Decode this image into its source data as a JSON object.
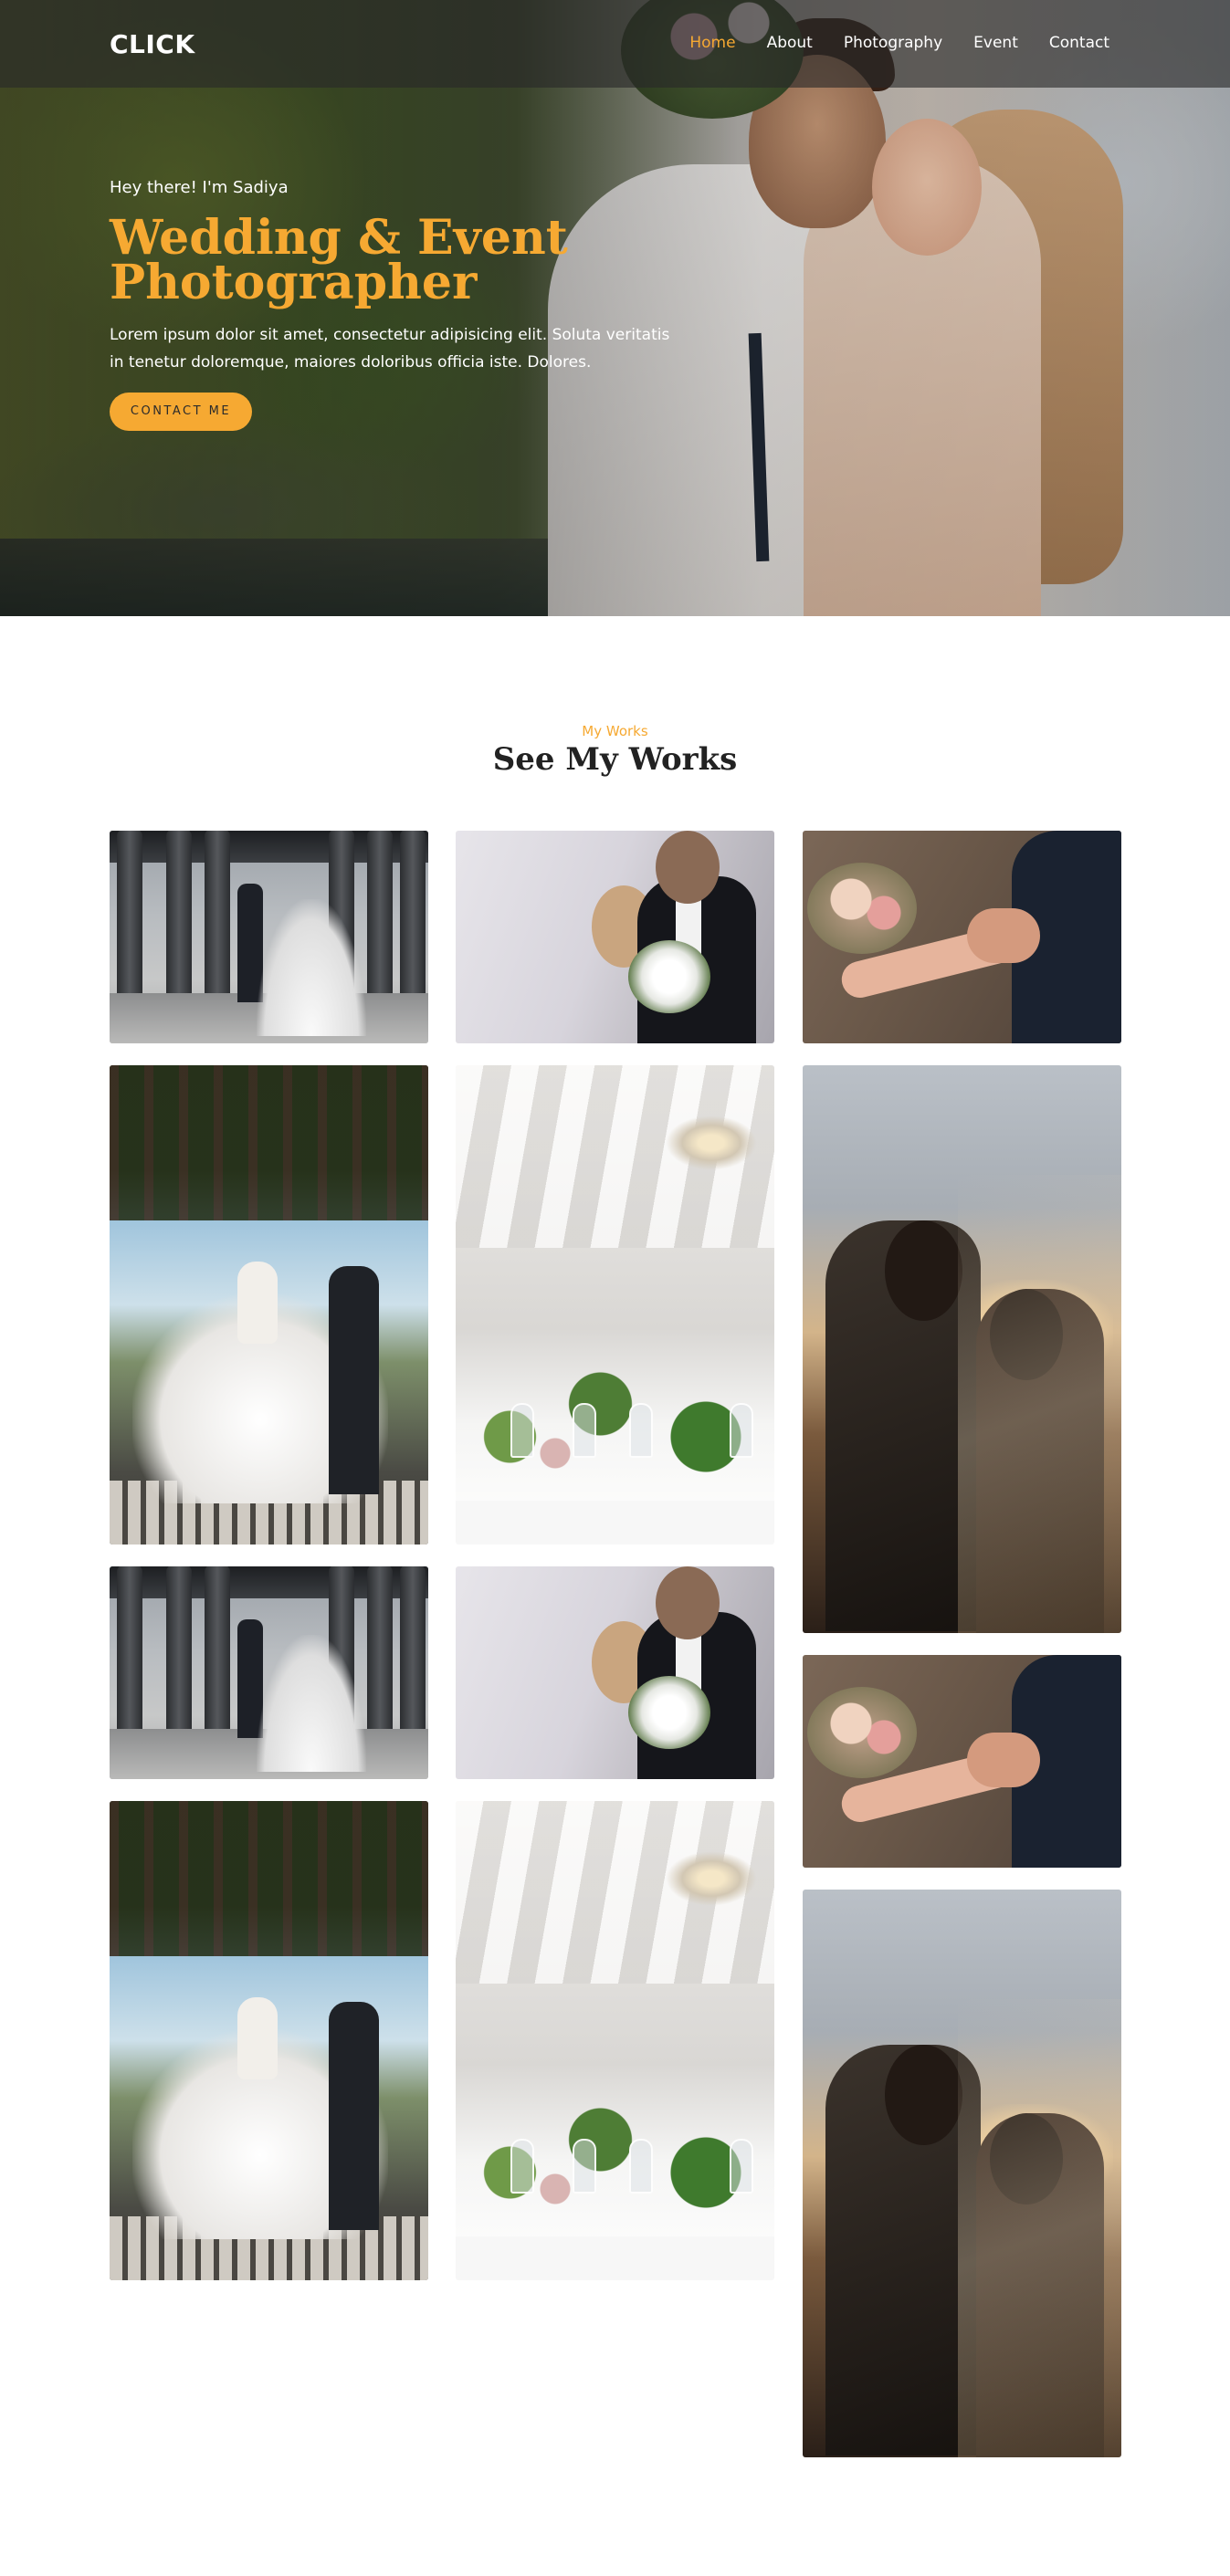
{
  "brand": {
    "logo": "CLICK"
  },
  "nav": {
    "items": [
      {
        "label": "Home",
        "active": true
      },
      {
        "label": "About",
        "active": false
      },
      {
        "label": "Photography",
        "active": false
      },
      {
        "label": "Event",
        "active": false
      },
      {
        "label": "Contact",
        "active": false
      }
    ]
  },
  "hero": {
    "greeting": "Hey there! I'm Sadiya",
    "title_line1": "Wedding & Event",
    "title_line2": "Photographer",
    "description": "Lorem ipsum dolor sit amet, consectetur adipisicing elit. Soluta veritatis in tenetur doloremque, maiores doloribus officia iste. Dolores.",
    "button_label": "CONTACT ME"
  },
  "works": {
    "subtitle": "My Works",
    "title": "See My Works"
  },
  "colors": {
    "accent": "#f6a932",
    "nav_bar": "#282828",
    "text_dark": "#222222",
    "background": "#ffffff"
  }
}
